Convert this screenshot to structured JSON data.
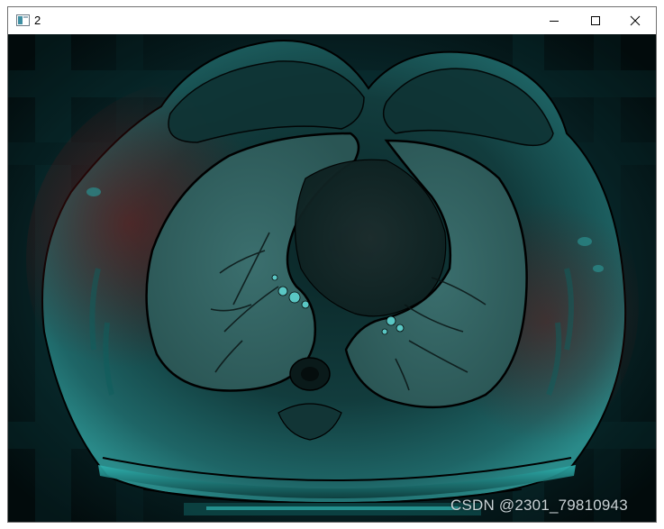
{
  "window": {
    "title": "2",
    "icon": "window-app-icon",
    "controls": {
      "minimize_icon": "minimize-icon",
      "maximize_icon": "maximize-icon",
      "close_icon": "close-icon"
    }
  },
  "image": {
    "description_icon": "ct-scan-image",
    "palette": {
      "background": "#031415",
      "cyan": "#1fa3a2",
      "red": "#7a1414"
    }
  },
  "watermark": {
    "text": "CSDN @2301_79810943"
  }
}
